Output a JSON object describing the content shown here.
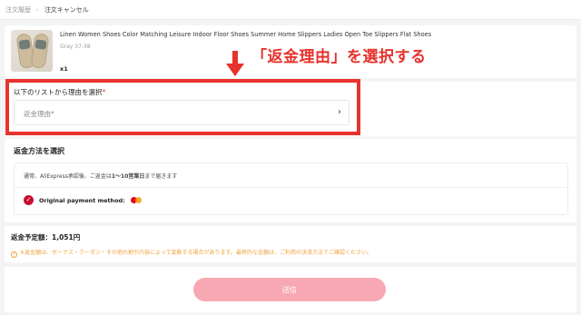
{
  "breadcrumb": {
    "items": [
      "注文履歴",
      "注文キャンセル"
    ],
    "separator": "›"
  },
  "product": {
    "title": "Linen Women Shoes Color Matching Leisure Indoor Floor Shoes Summer Home Slippers Ladies Open Toe Slippers Flat Shoes",
    "variant": "Gray 37-38",
    "quantity": "x1"
  },
  "annotation": {
    "text": "「返金理由」を選択する",
    "color": "#e8322d"
  },
  "reason": {
    "label": "以下のリストから理由を選択",
    "required_mark": "*",
    "placeholder": "返金理由*",
    "chevron": "›"
  },
  "refund_method": {
    "title": "返金方法を選択",
    "note_prefix": "通常、AliExpress承認後、ご返金は",
    "note_bold": "1〜10営業日",
    "note_suffix": "まで届きます",
    "payment_label": "Original payment method:",
    "payment_icon": "mastercard-icon"
  },
  "refund_amount": {
    "label": "返金予定額：",
    "value": "1,051円",
    "note": "※返金額は、ボーナス・クーポン・その他の割引内容によって変動する場合があります。最終的な金額は、ご利用の決済方法でご確認ください。"
  },
  "submit": {
    "label": "送信"
  },
  "colors": {
    "accent": "#e8322d",
    "brand_red": "#c8102e",
    "submit_disabled": "#f8a8b2",
    "warning": "#f0a23a"
  }
}
